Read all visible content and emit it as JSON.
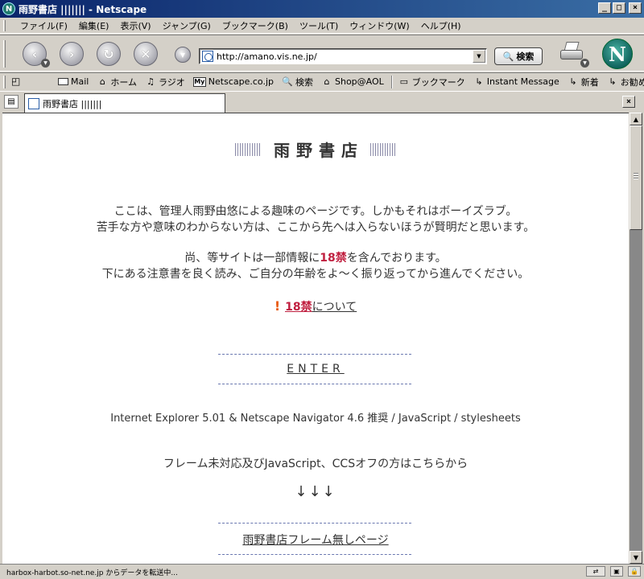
{
  "window": {
    "title": "雨野書店 ||||||| - Netscape",
    "app_icon_letter": "N",
    "minimize": "_",
    "maximize": "□",
    "close": "×"
  },
  "menubar": {
    "items": [
      {
        "label": "ファイル(F)"
      },
      {
        "label": "編集(E)"
      },
      {
        "label": "表示(V)"
      },
      {
        "label": "ジャンプ(G)"
      },
      {
        "label": "ブックマーク(B)"
      },
      {
        "label": "ツール(T)"
      },
      {
        "label": "ウィンドウ(W)"
      },
      {
        "label": "ヘルプ(H)"
      }
    ]
  },
  "navbar": {
    "url": "http://amano.vis.ne.jp/",
    "search_label": "検索",
    "logo_letter": "N"
  },
  "personal_toolbar": {
    "items": [
      {
        "icon": "mail-icon",
        "label": "Mail"
      },
      {
        "icon": "home-icon",
        "label": "ホーム"
      },
      {
        "icon": "radio-icon",
        "label": "ラジオ"
      },
      {
        "icon": "my-netscape-icon",
        "icon_text": "My",
        "label": "Netscape.co.jp"
      },
      {
        "icon": "search-icon",
        "label": "検索"
      },
      {
        "icon": "shop-icon",
        "label": "Shop@AOL"
      },
      {
        "icon": "bookmark-folder-icon",
        "label": "ブックマーク"
      },
      {
        "icon": "link-icon",
        "label": "Instant Message"
      },
      {
        "icon": "link-icon",
        "label": "新着"
      },
      {
        "icon": "link-icon",
        "label": "お勧め"
      }
    ]
  },
  "tab": {
    "label": "雨野書店 |||||||",
    "close": "×"
  },
  "page": {
    "site_name": "雨野書店",
    "intro_line1": "ここは、管理人雨野由悠による趣味のページです。しかもそれはボーイズラブ。",
    "intro_line2": "苦手な方や意味のわからない方は、ここから先へは入らないほうが賢明だと思います。",
    "notice_line1_pre": "尚、等サイトは一部情報に",
    "notice_line1_age": "18禁",
    "notice_line1_post": "を含んでおります。",
    "notice_line2": "下にある注意書を良く読み、ご自分の年齢をよ～く振り返ってから進んでください。",
    "age_link_bang": "!",
    "age_link_age": "18禁",
    "age_link_rest": "について",
    "enter": "ENTER",
    "browser_note": "Internet Explorer 5.01 & Netscape Navigator 4.6 推奨 / JavaScript / stylesheets",
    "frame_note": "フレーム未対応及びJavaScript、CCSオフの方はこちらから",
    "arrows": "↓↓↓",
    "noframe_link": "雨野書店フレーム無しページ"
  },
  "status": {
    "text": "harbox-harbot.so-net.ne.jp からデータを転送中..."
  }
}
